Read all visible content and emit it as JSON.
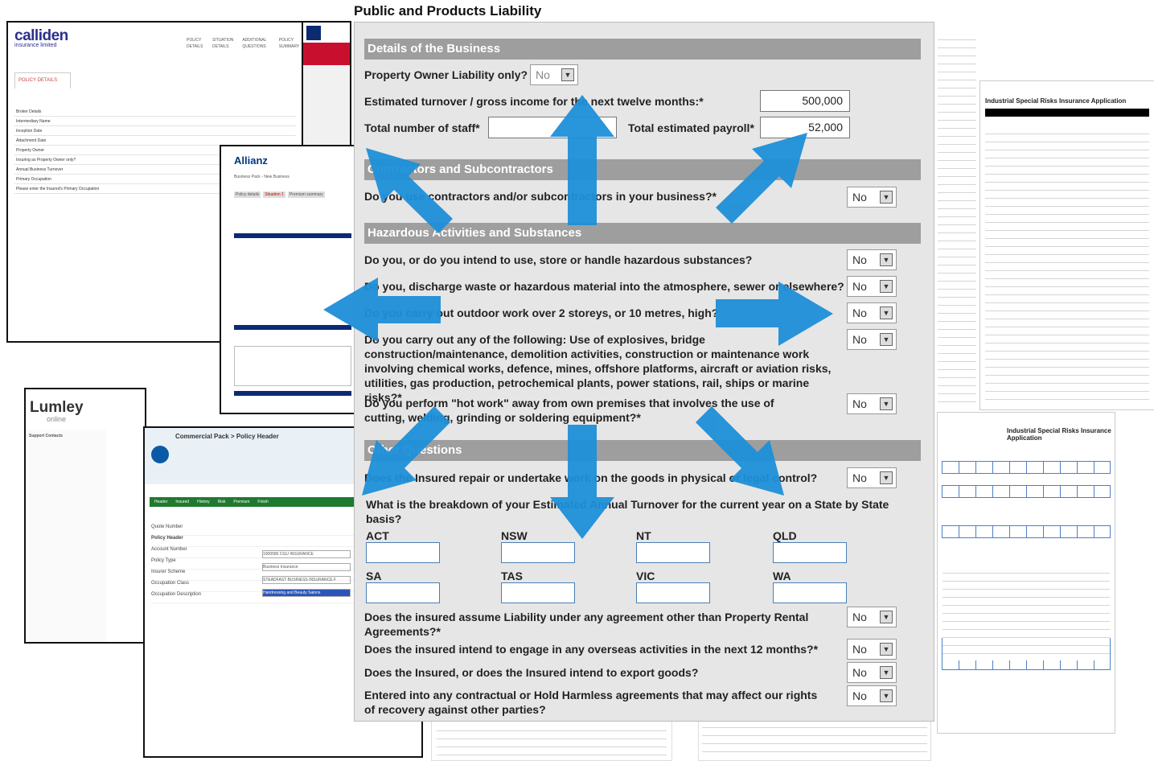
{
  "page_title": "Public and Products Liability",
  "background": {
    "calliden": {
      "logo": "calliden",
      "sub": "insurance limited",
      "tab": "POLICY DETAILS",
      "header_tabs": [
        "POLICY DETAILS",
        "SITUATION DETAILS",
        "ADDITIONAL QUESTIONS",
        "POLICY SUMMARY"
      ],
      "rows": [
        "Broker Details",
        "Intermediary Name",
        "Inception Date",
        "Attachment Date",
        "Property Owner",
        "Insuring as Property Owner only?",
        "Annual Business Turnover",
        "Primary Occupation",
        "Please enter the Insured's Primary Occupation"
      ]
    },
    "allianz": {
      "logo": "Allianz",
      "sub": "Business Pack - New Business",
      "tabs": [
        "Policy details",
        "Situation 1",
        "Premium summary"
      ]
    },
    "lumley": {
      "logo": "Lumley",
      "sub": "online",
      "side_title": "Support Contacts"
    },
    "cgu": {
      "title": "Commercial Pack > Policy Header",
      "tabs": [
        "Header",
        "Insured",
        "History",
        "Risk",
        "Premium",
        "Finish"
      ],
      "rows": [
        "Quote Number",
        "Policy Header",
        "Account Number",
        "Policy Type",
        "Insurer Scheme",
        "Occupation Class",
        "Occupation Description"
      ],
      "values": [
        "1000586 CGU INSURANCE",
        "Business Insurance",
        "STEADFAST BUSINESS INSURANCE F",
        "Hairdressing and Beauty Salons"
      ]
    },
    "isr": {
      "title": "Industrial Special Risks Insurance Application",
      "title2": "Industrial Special Risks Insurance Application"
    }
  },
  "form": {
    "sections": {
      "business": "Details of the Business",
      "contractors": "Contractors and Subcontractors",
      "hazardous": "Hazardous Activities and Substances",
      "other": "Other Questions"
    },
    "property_owner_label": "Property Owner Liability only?",
    "property_owner_value": "No",
    "turnover_label": "Estimated turnover / gross income for the next twelve months:*",
    "turnover_value": "500,000",
    "staff_label": "Total number of staff*",
    "staff_value": "",
    "payroll_label": "Total estimated payroll*",
    "payroll_value": "52,000",
    "contractors_q": "Do you use contractors and/or subcontractors in your business?*",
    "contractors_a": "No",
    "haz": [
      {
        "q": "Do you, or do you intend to use, store or handle hazardous substances?",
        "a": "No"
      },
      {
        "q": "Do you, discharge waste or hazardous material into the atmosphere, sewer or elsewhere?",
        "a": "No"
      },
      {
        "q": "Do you carry out outdoor work over 2 storeys, or 10 metres, high?",
        "a": "No"
      },
      {
        "q": "Do you carry out any of the following: Use of explosives, bridge construction/maintenance, demolition activities, construction or maintenance work involving chemical works, defence, mines, offshore platforms, aircraft or aviation risks, utilities, gas production, petrochemical plants, power stations, rail, ships or marine risks?*",
        "a": "No"
      },
      {
        "q": "Do you perform \"hot work\" away from own premises that involves the use of cutting, welding, grinding or soldering equipment?*",
        "a": "No"
      }
    ],
    "repair_q": "Does the Insured repair or undertake work on the goods in physical or legal control?",
    "repair_a": "No",
    "breakdown_q": "What is the breakdown of your Estimated Annual Turnover for the current year on a State by State basis?",
    "states": [
      "ACT",
      "NSW",
      "NT",
      "QLD",
      "SA",
      "TAS",
      "VIC",
      "WA"
    ],
    "other": [
      {
        "q": "Does the insured assume Liability under any agreement other than Property Rental Agreements?*",
        "a": "No"
      },
      {
        "q": "Does the insured intend to engage in any overseas activities in the next 12 months?*",
        "a": "No"
      },
      {
        "q": "Does the Insured, or does the Insured intend to export goods?",
        "a": "No"
      },
      {
        "q": "Entered into any contractual or Hold Harmless agreements that may affect our rights of recovery against other parties?",
        "a": "No"
      }
    ]
  },
  "colors": {
    "arrow": "#1e8fd8",
    "section_bg": "#9e9e9e",
    "form_bg": "#e6e6e6"
  }
}
